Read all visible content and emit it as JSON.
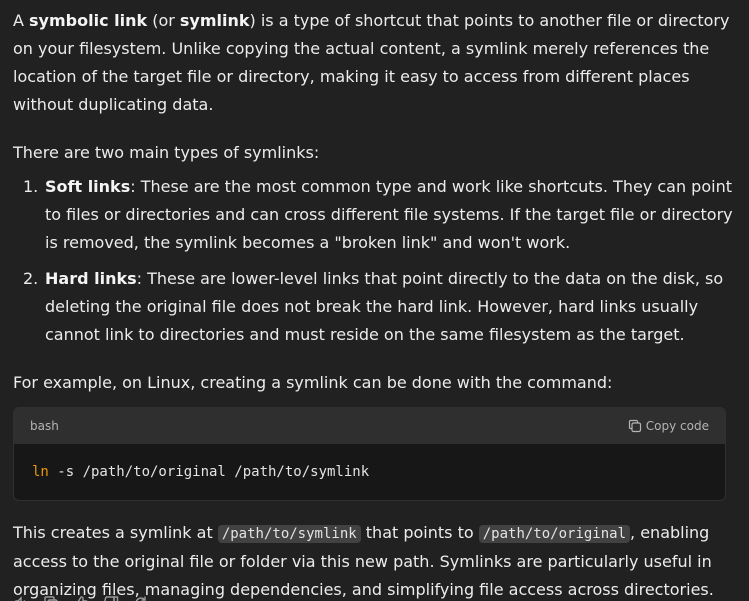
{
  "intro": {
    "text_a": "A ",
    "term1": "symbolic link",
    "text_b": " (or ",
    "term2": "symlink",
    "text_c": ") is a type of shortcut that points to another file or directory on your filesystem. Unlike copying the actual content, a symlink merely references the location of the target file or directory, making it easy to access from different places without duplicating data."
  },
  "types_intro": "There are two main types of symlinks:",
  "types": [
    {
      "number": "1.",
      "title": "Soft links",
      "description": ": These are the most common type and work like shortcuts. They can point to files or directories and can cross different file systems. If the target file or directory is removed, the symlink becomes a \"broken link\" and won't work."
    },
    {
      "number": "2.",
      "title": "Hard links",
      "description": ": These are lower-level links that point directly to the data on the disk, so deleting the original file does not break the hard link. However, hard links usually cannot link to directories and must reside on the same filesystem as the target."
    }
  ],
  "example_intro": "For example, on Linux, creating a symlink can be done with the command:",
  "code_block": {
    "language": "bash",
    "copy_label": "Copy code",
    "command": "ln",
    "args": " -s /path/to/original /path/to/symlink"
  },
  "closing": {
    "text_a": "This creates a symlink at ",
    "code1": "/path/to/symlink",
    "text_b": " that points to ",
    "code2": "/path/to/original",
    "text_c": ", enabling access to the original file or folder via this new path. Symlinks are particularly useful in organizing files, managing dependencies, and simplifying file access across directories."
  },
  "action_icons": [
    "read-aloud-icon",
    "copy-icon",
    "thumbs-up-icon",
    "thumbs-down-icon",
    "regenerate-icon"
  ]
}
